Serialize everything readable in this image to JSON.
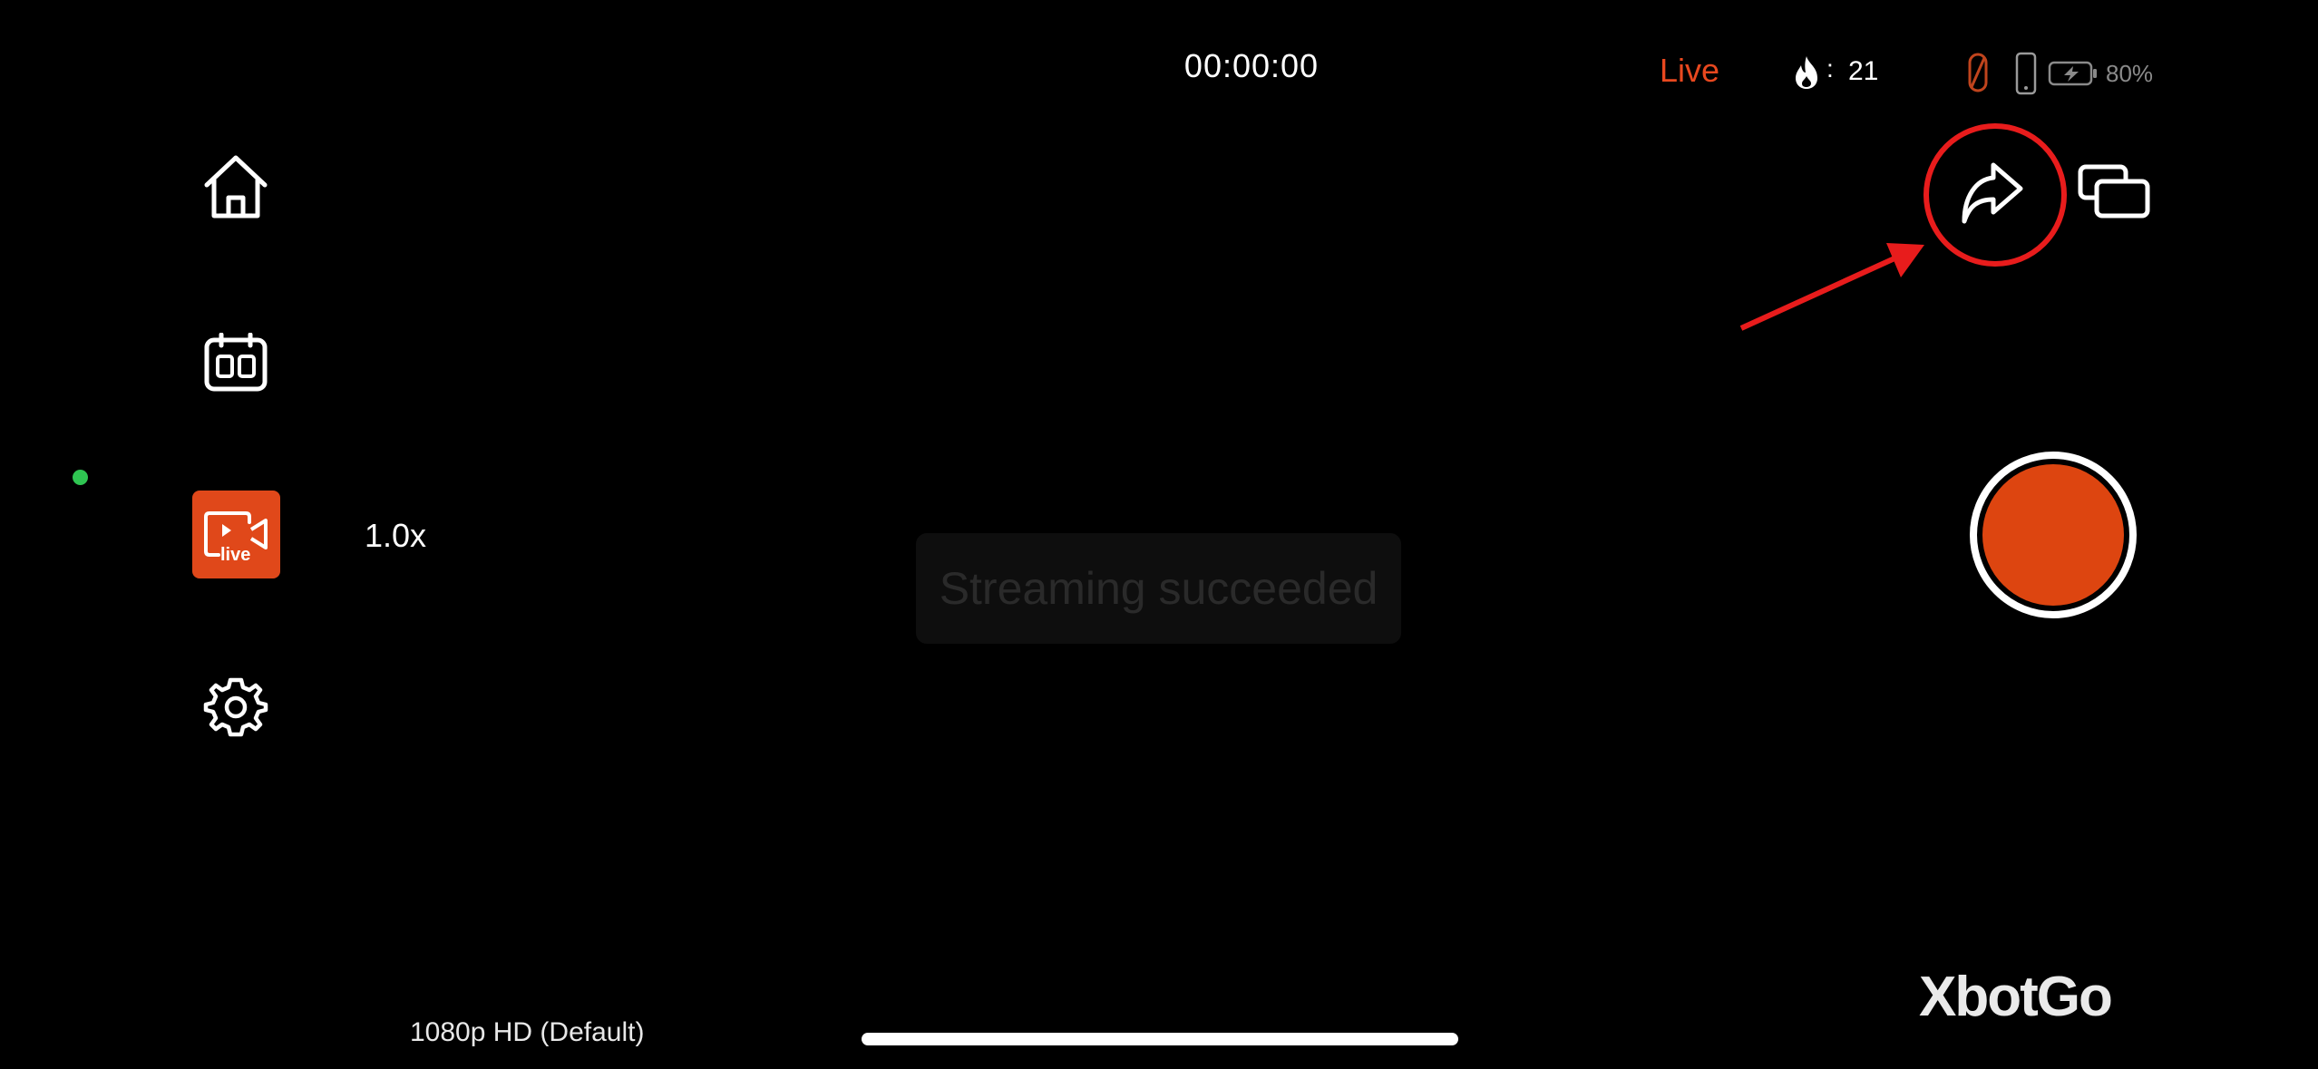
{
  "status_bar": {
    "timer": "00:00:00",
    "live_label": "Live",
    "viewer_separator": ":",
    "viewer_count": "21",
    "battery_percent": "80%",
    "icons": [
      "flame-icon",
      "gimbal-status-icon",
      "phone-icon",
      "battery-charging-icon"
    ]
  },
  "sidebar": {
    "items": [
      {
        "name": "home",
        "icon": "home-icon"
      },
      {
        "name": "schedule",
        "icon": "calendar-icon"
      },
      {
        "name": "live",
        "icon": "live-video-icon",
        "badge_text": "live",
        "active": true
      },
      {
        "name": "settings",
        "icon": "gear-icon"
      }
    ],
    "connection_dot_color": "#2fc552"
  },
  "camera": {
    "zoom": "1.0x",
    "resolution": "1080p HD (Default)"
  },
  "toast": {
    "message": "Streaming succeeded"
  },
  "controls": {
    "share_icon": "share-arrow-icon",
    "multi_screen_icon": "multi-screen-icon",
    "record_color": "#dd4510"
  },
  "annotation": {
    "color": "#e81c1c"
  },
  "brand": {
    "logo": "XbotGo"
  },
  "colors": {
    "accent": "#e0481a",
    "live_text": "#e8481f",
    "background": "#000000"
  }
}
